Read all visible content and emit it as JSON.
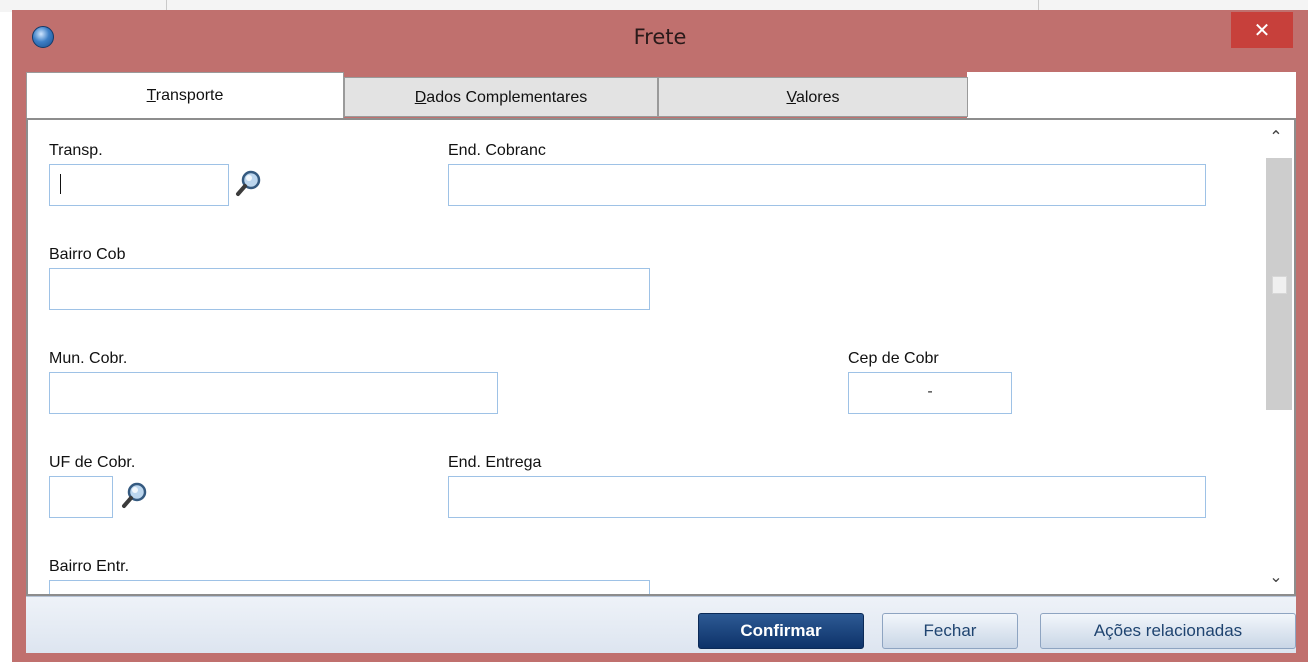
{
  "window": {
    "title": "Frete",
    "close_glyph": "✕"
  },
  "tabs": [
    {
      "label": "Transporte",
      "mnemonic": "T",
      "rest": "ransporte",
      "active": true
    },
    {
      "label": "Dados Complementares",
      "mnemonic": "D",
      "rest": "ados Complementares",
      "active": false
    },
    {
      "label": "Valores",
      "mnemonic": "V",
      "rest": "alores",
      "active": false
    }
  ],
  "form": {
    "transp": {
      "label": "Transp.",
      "value": ""
    },
    "end_cobranc": {
      "label": "End. Cobranc",
      "value": ""
    },
    "bairro_cob": {
      "label": "Bairro Cob",
      "value": ""
    },
    "mun_cobr": {
      "label": "Mun. Cobr.",
      "value": ""
    },
    "cep_cobr": {
      "label": "Cep de Cobr",
      "value": "-"
    },
    "uf_cobr": {
      "label": "UF de Cobr.",
      "value": ""
    },
    "end_entrega": {
      "label": "End. Entrega",
      "value": ""
    },
    "bairro_entr": {
      "label": "Bairro Entr.",
      "value": ""
    }
  },
  "footer": {
    "confirm_label": "Confirmar",
    "close_label": "Fechar",
    "related_actions_label": "Ações relacionadas"
  },
  "icons": {
    "lookup": "magnifier-icon",
    "app": "app-globe-icon",
    "scroll_up": "chevron-up-icon",
    "scroll_down": "chevron-down-icon"
  },
  "colors": {
    "title_bar": "#c0706e",
    "close_button": "#c7403b",
    "primary_button": "#0d3269",
    "input_border": "#9ec2e6"
  }
}
